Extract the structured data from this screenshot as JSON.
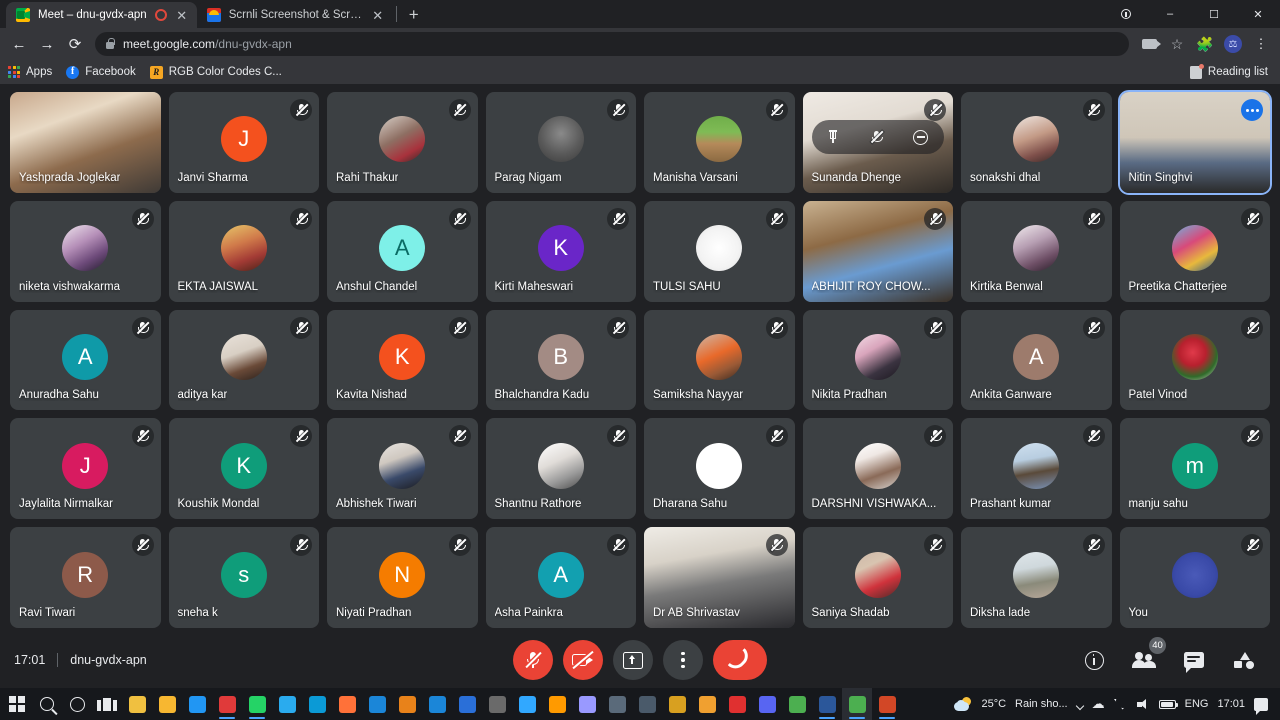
{
  "browser": {
    "tabs": [
      {
        "title": "Meet – dnu-gvdx-apn",
        "favicon": "google-meet-icon",
        "recording": true,
        "active": true
      },
      {
        "title": "Scrnli Screenshot & Screen Video",
        "favicon": "scrnli-icon",
        "recording": false,
        "active": false
      }
    ],
    "new_tab_label": "+",
    "window_controls": {
      "minimize": "–",
      "maximize": "☐",
      "close": "✕"
    },
    "nav": {
      "back": "←",
      "forward": "→",
      "reload": "⟳"
    },
    "omnibox": {
      "domain": "meet.google.com",
      "path": "/dnu-gvdx-apn",
      "lock_icon": "lock-icon"
    },
    "toolbar_icons": [
      "camera-icon",
      "bookmark-star-icon",
      "extensions-puzzle-icon",
      "profile-avatar",
      "chrome-menu-icon"
    ],
    "bookmarks": [
      {
        "label": "Apps",
        "icon": "apps-grid-icon"
      },
      {
        "label": "Facebook",
        "icon": "facebook-icon"
      },
      {
        "label": "RGB Color Codes C...",
        "icon": "rgb-color-codes-icon"
      }
    ],
    "reading_list_label": "Reading list"
  },
  "meet": {
    "time": "17:01",
    "meeting_code": "dnu-gvdx-apn",
    "participant_count": "40",
    "controls": [
      {
        "name": "microphone-off-button",
        "label": "Turn on microphone",
        "state": "off",
        "color": "#ea4335"
      },
      {
        "name": "camera-off-button",
        "label": "Turn on camera",
        "state": "off",
        "color": "#ea4335"
      },
      {
        "name": "present-now-button",
        "label": "Present now",
        "state": "idle",
        "color": "#3c4043"
      },
      {
        "name": "more-options-button",
        "label": "More options",
        "state": "idle",
        "color": "#3c4043"
      },
      {
        "name": "leave-call-button",
        "label": "Leave call",
        "state": "idle",
        "color": "#ea4335"
      }
    ],
    "right_controls": [
      {
        "name": "meeting-details-button",
        "label": "Meeting details"
      },
      {
        "name": "show-everyone-button",
        "label": "Show everyone",
        "badge": "40"
      },
      {
        "name": "chat-button",
        "label": "Chat with everyone"
      },
      {
        "name": "activities-button",
        "label": "Activities"
      }
    ],
    "hover_overlay": {
      "pin": "Pin",
      "mute": "Mute",
      "remove": "Remove"
    },
    "participants": [
      {
        "name": "Yashprada Joglekar",
        "type": "video",
        "muted": false,
        "bg": "linear-gradient(160deg,#c8a88c 0%,#e8d9c4 30%,#8d6b4d 60%,#3f3a36 100%)"
      },
      {
        "name": "Janvi Sharma",
        "type": "initial",
        "initial": "J",
        "color": "#f4511e",
        "muted": true
      },
      {
        "name": "Rahi Thakur",
        "type": "photo",
        "muted": true,
        "bg": "linear-gradient(150deg,#d8d0c8 0%,#8e6f63 45%,#a8323c 75%,#2f2a28 100%)"
      },
      {
        "name": "Parag Nigam",
        "type": "photo",
        "muted": true,
        "bg": "radial-gradient(circle at 50% 38%,#8a8a8a 0%,#5a5a5a 55%,#3a3a3a 100%)"
      },
      {
        "name": "Manisha Varsani",
        "type": "photo",
        "muted": true,
        "bg": "linear-gradient(180deg,#6fae4a 0%,#7fbb55 35%,#b58a5a 60%,#8b6a42 100%)"
      },
      {
        "name": "Sunanda Dhenge",
        "type": "video",
        "muted": true,
        "hover": true,
        "bg": "linear-gradient(165deg,#efeae4 0%,#e2dbd2 35%,#6b5c4d 62%,#2e2a26 100%)"
      },
      {
        "name": "sonakshi dhal",
        "type": "photo",
        "muted": true,
        "bg": "linear-gradient(160deg,#efe7e2 0%,#c39a86 45%,#7e4f4a 75%,#3a2a28 100%)"
      },
      {
        "name": "Nitin Singhvi",
        "type": "video",
        "muted": false,
        "selected": true,
        "bg": "linear-gradient(180deg,#d9d2c6 0%,#cfc6b8 45%,#5a6b84 70%,#2a2a2a 100%)"
      },
      {
        "name": "niketa vishwakarma",
        "type": "photo",
        "muted": true,
        "bg": "linear-gradient(150deg,#efe6ee 0%,#b58fb8 40%,#6d4a7a 70%,#241d2e 100%)"
      },
      {
        "name": "EKTA JAISWAL",
        "type": "photo",
        "muted": true,
        "bg": "linear-gradient(160deg,#e7c76a 0%,#d07a4a 40%,#a33b35 70%,#4a2418 100%)"
      },
      {
        "name": "Anshul Chandel",
        "type": "initial",
        "initial": "A",
        "color": "#7ef0e8",
        "text_color": "#0b6b64",
        "muted": true
      },
      {
        "name": "Kirti Maheswari",
        "type": "initial",
        "initial": "K",
        "color": "#6a26c8",
        "muted": true
      },
      {
        "name": "TULSI SAHU",
        "type": "photo",
        "muted": true,
        "bg": "radial-gradient(circle at 50% 50%,#ffffff 0%,#f3f3f3 60%,#dedede 100%)"
      },
      {
        "name": "ABHIJIT ROY CHOW...",
        "type": "video",
        "muted": true,
        "bg": "linear-gradient(165deg,#c9b291 0%,#8d6a45 35%,#6a9bd1 62%,#3a2f24 100%)"
      },
      {
        "name": "Kirtika Benwal",
        "type": "photo",
        "muted": true,
        "bg": "linear-gradient(155deg,#f2ecef 0%,#b79fb3 40%,#6e4f66 72%,#2a1f2a 100%)"
      },
      {
        "name": "Preetika Chatterjee",
        "type": "photo",
        "muted": true,
        "bg": "linear-gradient(150deg,#6fb3e0 0%,#d84a7a 40%,#e8b93c 70%,#2f5a8a 100%)"
      },
      {
        "name": "Anuradha Sahu",
        "type": "initial",
        "initial": "A",
        "color": "#0f9aa8",
        "muted": true
      },
      {
        "name": "aditya kar",
        "type": "photo",
        "muted": true,
        "bg": "linear-gradient(160deg,#e9e2da 0%,#d8cfc4 40%,#6a4a38 70%,#2b211c 100%)"
      },
      {
        "name": "Kavita Nishad",
        "type": "initial",
        "initial": "K",
        "color": "#f4511e",
        "muted": true
      },
      {
        "name": "Bhalchandra Kadu",
        "type": "initial",
        "initial": "B",
        "color": "#a38b84",
        "muted": true
      },
      {
        "name": "Samiksha Nayyar",
        "type": "photo",
        "muted": true,
        "bg": "linear-gradient(155deg,#cdb8a8 0%,#e8692a 45%,#9a5a36 72%,#3a2a20 100%)"
      },
      {
        "name": "Nikita Pradhan",
        "type": "photo",
        "muted": true,
        "bg": "linear-gradient(150deg,#f3dde6 0%,#d9a5bc 35%,#3a3340 70%,#1c1820 100%)"
      },
      {
        "name": "Ankita Ganware",
        "type": "initial",
        "initial": "A",
        "color": "#9d7b6c",
        "muted": true
      },
      {
        "name": "Patel Vinod",
        "type": "photo",
        "muted": true,
        "bg": "radial-gradient(circle at 45% 40%,#e03a4a 0%,#b8202e 35%,#2f6b2a 65%,#e8e2da 100%)"
      },
      {
        "name": "Jaylalita Nirmalkar",
        "type": "initial",
        "initial": "J",
        "color": "#d81b60",
        "muted": true
      },
      {
        "name": "Koushik Mondal",
        "type": "initial",
        "initial": "K",
        "color": "#0f9d7a",
        "muted": true
      },
      {
        "name": "Abhishek Tiwari",
        "type": "photo",
        "muted": true,
        "bg": "linear-gradient(160deg,#e8e4e0 0%,#cfc8c0 35%,#3a4a6a 65%,#1c1c20 100%)"
      },
      {
        "name": "Shantnu Rathore",
        "type": "photo",
        "muted": true,
        "bg": "linear-gradient(155deg,#ffffff 0%,#e0dcd8 40%,#9a9a9a 70%,#4a4a4a 100%)"
      },
      {
        "name": "Dharana Sahu",
        "type": "photo",
        "muted": true,
        "bg": "#ffffff"
      },
      {
        "name": "DARSHNI VISHWAKA...",
        "type": "photo",
        "muted": true,
        "bg": "linear-gradient(160deg,#ffffff 0%,#efe8e4 30%,#8a6a58 65%,#d8d4d0 100%)"
      },
      {
        "name": "Prashant kumar",
        "type": "photo",
        "muted": true,
        "bg": "linear-gradient(170deg,#cfe0ef 0%,#b8cde0 35%,#5a4a3a 62%,#7a93b8 100%)"
      },
      {
        "name": "manju sahu",
        "type": "initial",
        "initial": "m",
        "color": "#0f9d7a",
        "muted": true
      },
      {
        "name": "Ravi Tiwari",
        "type": "initial",
        "initial": "R",
        "color": "#8d5a4a",
        "muted": true
      },
      {
        "name": "sneha k",
        "type": "initial",
        "initial": "s",
        "color": "#0f9d7a",
        "muted": true
      },
      {
        "name": "Niyati Pradhan",
        "type": "initial",
        "initial": "N",
        "color": "#f57c00",
        "muted": true
      },
      {
        "name": "Asha Painkra",
        "type": "initial",
        "initial": "A",
        "color": "#12a0b0",
        "muted": true
      },
      {
        "name": "Dr AB Shrivastav",
        "type": "video",
        "muted": true,
        "bg": "linear-gradient(170deg,#efece6 0%,#d8d2c8 30%,#7a7a7a 55%,#2a2a2e 100%)"
      },
      {
        "name": "Saniya Shadab",
        "type": "photo",
        "muted": true,
        "bg": "linear-gradient(155deg,#cdb8a8 0%,#d8c4b0 30%,#d0333c 65%,#4a2a28 100%)"
      },
      {
        "name": "Diksha lade",
        "type": "photo",
        "muted": true,
        "bg": "linear-gradient(170deg,#dfe6ea 0%,#cfd8dc 35%,#8a8a7a 65%,#b8a89a 100%)"
      },
      {
        "name": "You",
        "type": "photo",
        "muted": true,
        "bg": "radial-gradient(circle at 50% 50%,#4a5ab8 0%,#3a4aa8 60%,#2a3a90 100%)"
      }
    ]
  },
  "taskbar": {
    "start_label": "Start",
    "items": [
      {
        "name": "start-button",
        "icon": "windows-logo-icon"
      },
      {
        "name": "search-button",
        "icon": "search-icon"
      },
      {
        "name": "cortana-button",
        "icon": "cortana-circle-icon"
      },
      {
        "name": "task-view-button",
        "icon": "task-view-icon"
      },
      {
        "name": "taskbar-app-store",
        "icon": "microsoft-store-icon",
        "color": "#f0c040"
      },
      {
        "name": "taskbar-app-explorer",
        "icon": "file-explorer-icon",
        "color": "#f7b731"
      },
      {
        "name": "taskbar-app-mail",
        "icon": "mail-icon",
        "color": "#2196f3"
      },
      {
        "name": "taskbar-app-zoom",
        "icon": "zoom-icon",
        "color": "#e03a3a",
        "running": true
      },
      {
        "name": "taskbar-app-whatsapp",
        "icon": "whatsapp-icon",
        "color": "#25d366",
        "running": true
      },
      {
        "name": "taskbar-app-telegram",
        "icon": "telegram-icon",
        "color": "#2aabee"
      },
      {
        "name": "taskbar-app-edge",
        "icon": "edge-icon",
        "color": "#0b9ad6"
      },
      {
        "name": "taskbar-app-firefox",
        "icon": "firefox-icon",
        "color": "#ff7139"
      },
      {
        "name": "taskbar-app-opera",
        "icon": "opera-gx-icon",
        "color": "#1b86d8"
      },
      {
        "name": "taskbar-app-vlc",
        "icon": "vlc-icon",
        "color": "#e8821a"
      },
      {
        "name": "taskbar-app-filmora",
        "icon": "filmora-icon",
        "color": "#1b86d8"
      },
      {
        "name": "taskbar-app-premiere",
        "icon": "media-icon",
        "color": "#2a6fd8"
      },
      {
        "name": "taskbar-app-obs",
        "icon": "obs-icon",
        "color": "#6a6a6a"
      },
      {
        "name": "taskbar-app-photoshop",
        "icon": "photoshop-icon",
        "color": "#31a8ff"
      },
      {
        "name": "taskbar-app-illustrator",
        "icon": "illustrator-icon",
        "color": "#ff9a00"
      },
      {
        "name": "taskbar-app-aftereffects",
        "icon": "after-effects-icon",
        "color": "#9999ff"
      },
      {
        "name": "taskbar-app-dl",
        "icon": "download-manager-icon",
        "color": "#5a6a7a"
      },
      {
        "name": "taskbar-app-camtasia",
        "icon": "camtasia-icon",
        "color": "#4a5a6a"
      },
      {
        "name": "taskbar-app-pen",
        "icon": "pen-tool-icon",
        "color": "#d8a020"
      },
      {
        "name": "taskbar-app-audacity",
        "icon": "audacity-icon",
        "color": "#f0a030"
      },
      {
        "name": "taskbar-app-recorder",
        "icon": "screen-recorder-icon",
        "color": "#e03030"
      },
      {
        "name": "taskbar-app-discord",
        "icon": "discord-icon",
        "color": "#5865f2"
      },
      {
        "name": "taskbar-app-chrome",
        "icon": "chrome-icon",
        "color": "#4caf50"
      },
      {
        "name": "taskbar-app-word",
        "icon": "word-icon",
        "color": "#2b579a",
        "running": true
      },
      {
        "name": "taskbar-app-chrome-active",
        "icon": "chrome-icon",
        "color": "#4caf50",
        "running": true,
        "active": true
      },
      {
        "name": "taskbar-app-powerpoint",
        "icon": "powerpoint-icon",
        "color": "#d24726",
        "running": true
      }
    ],
    "tray": {
      "weather_temp": "25°C",
      "weather_desc": "Rain sho...",
      "overflow_icon": "chevron-up-icon",
      "icons": [
        "onedrive-icon",
        "wifi-icon",
        "volume-icon",
        "battery-icon"
      ],
      "language": "ENG",
      "clock": "17:01",
      "notification_icon": "notification-icon"
    }
  }
}
